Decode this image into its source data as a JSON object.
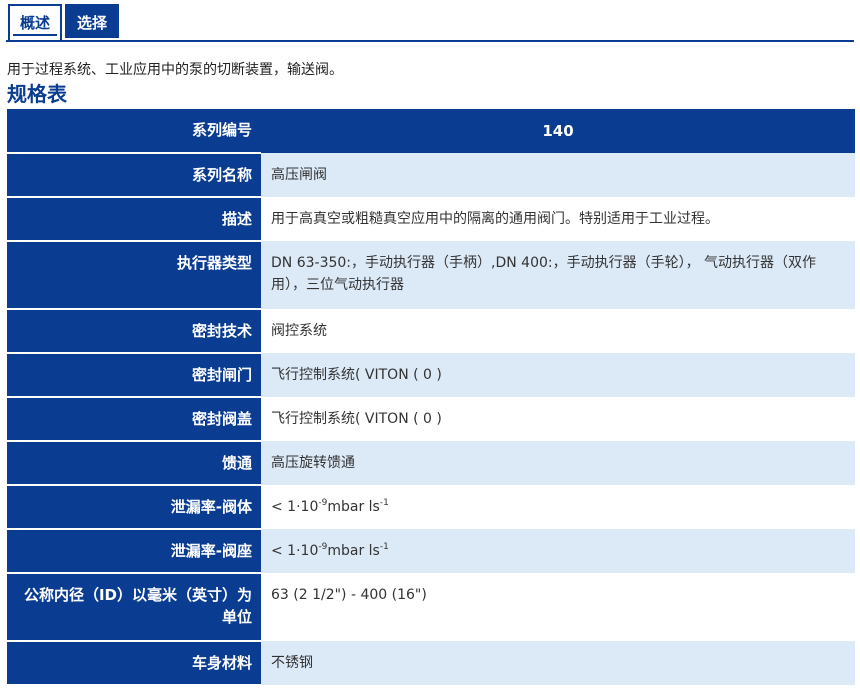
{
  "tabs": [
    {
      "label": "概述",
      "active": true
    },
    {
      "label": "选择",
      "active": false
    }
  ],
  "intro": "用于过程系统、工业应用中的泵的切断装置，输送阀。",
  "spec_title": "规格表",
  "spec": {
    "series_number": {
      "label": "系列编号",
      "value": "140"
    },
    "series_name": {
      "label": "系列名称",
      "value": "高压闸阀"
    },
    "description": {
      "label": "描述",
      "value": "用于高真空或粗糙真空应用中的隔离的通用阀门。特别适用于工业过程。"
    },
    "actuator": {
      "label": "执行器类型",
      "value": "DN 63-350:，手动执行器（手柄）,DN 400:，手动执行器（手轮），  气动执行器（双作用），三位气动执行器"
    },
    "sealing_tech": {
      "label": "密封技术",
      "value": "阀控系统"
    },
    "gate_seal": {
      "label": "密封闸门",
      "value": "飞行控制系统( VITON ( 0 )"
    },
    "bonnet_seal": {
      "label": "密封阀盖",
      "value": "飞行控制系统( VITON ( 0 )"
    },
    "feedthrough": {
      "label": "馈通",
      "value": "高压旋转馈通"
    },
    "leak_body": {
      "label": "泄漏率-阀体",
      "prefix": "< 1·10",
      "exp": "-9",
      "unit": "mbar ls",
      "unit_exp": "-1"
    },
    "leak_seat": {
      "label": "泄漏率-阀座",
      "prefix": "< 1·10",
      "exp": "-9",
      "unit": "mbar ls",
      "unit_exp": "-1"
    },
    "nominal_id": {
      "label": "公称内径（ID）以毫米（英寸）为单位",
      "value": "63 (2 1/2\") - 400 (16\")"
    },
    "body_material": {
      "label": "车身材料",
      "value": "不锈钢"
    }
  },
  "colors": {
    "accent": "#0a3d91",
    "row_alt": "#dceaf8"
  }
}
